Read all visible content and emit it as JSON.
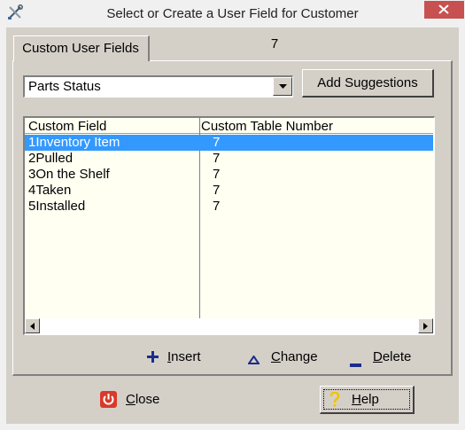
{
  "window": {
    "title": "Select or Create a User Field for Customer",
    "app_icon": "tools-icon",
    "close_icon": "close-icon"
  },
  "tab": {
    "label": "Custom User Fields",
    "count": "7"
  },
  "combo": {
    "value": "Parts Status",
    "arrow_icon": "chevron-down-icon"
  },
  "add_suggestions": {
    "label": "Add Suggestions"
  },
  "list": {
    "columns": [
      "Custom Field",
      "Custom Table Number"
    ],
    "rows": [
      {
        "field": "1Inventory Item",
        "table_number": "7",
        "selected": true
      },
      {
        "field": "2Pulled",
        "table_number": "7",
        "selected": false
      },
      {
        "field": "3On the Shelf",
        "table_number": "7",
        "selected": false
      },
      {
        "field": "4Taken",
        "table_number": "7",
        "selected": false
      },
      {
        "field": "5Installed",
        "table_number": "7",
        "selected": false
      }
    ],
    "selection_color": "#3399ff",
    "background_color": "#fffff2"
  },
  "actions": {
    "insert": {
      "label_first": "I",
      "label_rest": "nsert",
      "icon": "plus-icon"
    },
    "change": {
      "label_first": "C",
      "label_rest": "hange",
      "icon": "triangle-icon"
    },
    "delete": {
      "label_first": "D",
      "label_rest": "elete",
      "icon": "minus-icon"
    }
  },
  "footer": {
    "close": {
      "label_first": "C",
      "label_rest": "lose",
      "icon": "power-icon"
    },
    "help": {
      "label_first": "H",
      "label_rest": "elp",
      "icon": "question-icon"
    }
  },
  "colors": {
    "accent": "#3399ff",
    "close_red": "#c75050",
    "action_icon_blue": "#1c2c8c",
    "help_yellow": "#ffd200"
  }
}
